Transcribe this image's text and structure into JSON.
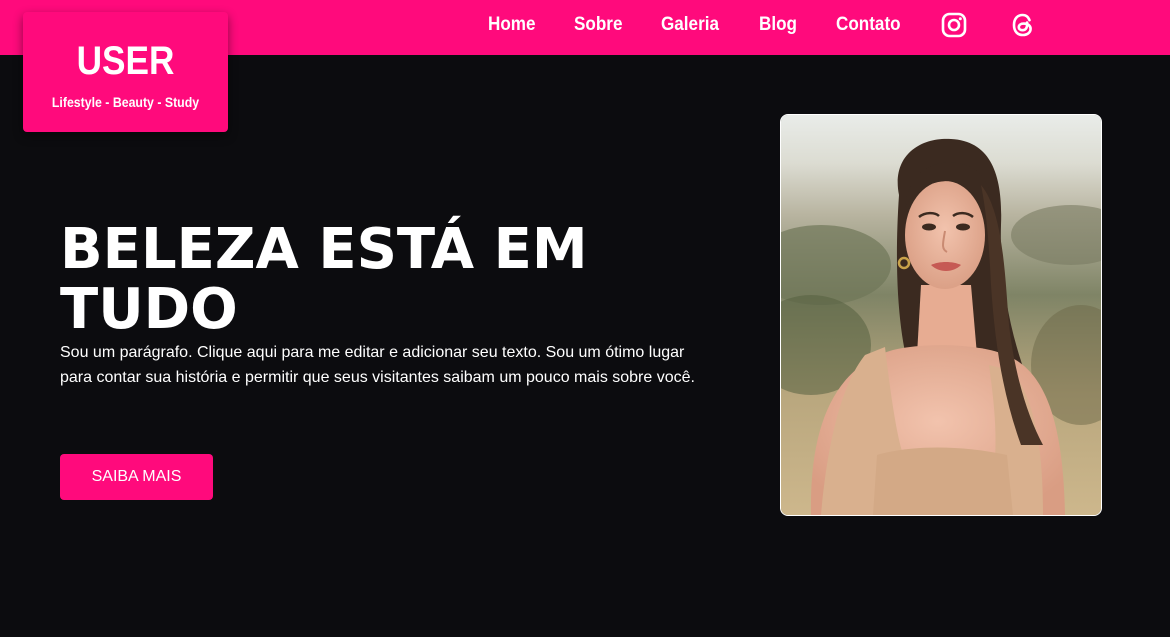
{
  "brand": {
    "name": "USER",
    "tagline": "Lifestyle - Beauty - Study"
  },
  "nav": {
    "items": [
      {
        "label": "Home"
      },
      {
        "label": "Sobre"
      },
      {
        "label": "Galeria"
      },
      {
        "label": "Blog"
      },
      {
        "label": "Contato"
      }
    ],
    "social": [
      {
        "icon": "instagram-icon"
      },
      {
        "icon": "threads-icon"
      }
    ]
  },
  "hero": {
    "title": "BELEZA ESTÁ EM TUDO",
    "paragraph": "Sou um parágrafo. Clique aqui para me editar e adicionar seu texto. Sou um ótimo lugar para contar sua história e permitir que seus visitantes saibam um pouco mais sobre você.",
    "button_label": "SAIBA MAIS"
  },
  "colors": {
    "accent": "#ff0a7c",
    "background": "#0c0c0f",
    "text": "#ffffff"
  }
}
